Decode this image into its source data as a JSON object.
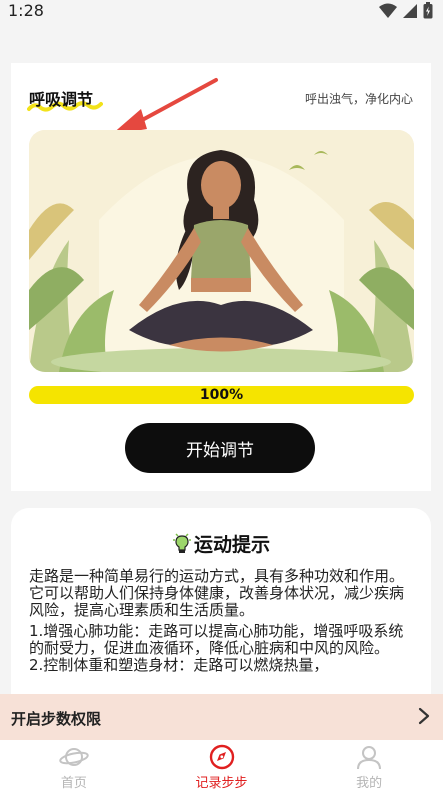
{
  "status_bar": {
    "time": "1:28",
    "icons": [
      "wifi-icon",
      "signal-icon",
      "battery-icon"
    ]
  },
  "breathing_card": {
    "title": "呼吸调节",
    "subtitle": "呼出浊气，净化内心",
    "progress_value": 100,
    "progress_label": "100%",
    "start_button_label": "开始调节",
    "progress_color": "#f5e400"
  },
  "tips_card": {
    "title": "运动提示",
    "icon": "lightbulb-icon",
    "paragraphs": [
      "走路是一种简单易行的运动方式，具有多种功效和作用。它可以帮助人们保持身体健康，改善身体状况，减少疾病风险，提高心理素质和生活质量。",
      "1.增强心肺功能：走路可以提高心肺功能，增强呼吸系统的耐受力，促进血液循环，降低心脏病和中风的风险。",
      "2.控制体重和塑造身材：走路可以燃烧热量，"
    ]
  },
  "banner": {
    "text": "开启步数权限",
    "icon": "chevron-right-icon"
  },
  "bottom_nav": {
    "items": [
      {
        "label": "首页",
        "icon": "planet-icon",
        "active": false
      },
      {
        "label": "记录步步",
        "icon": "compass-icon",
        "active": true
      },
      {
        "label": "我的",
        "icon": "user-icon",
        "active": false
      }
    ],
    "active_color": "#e02020"
  }
}
